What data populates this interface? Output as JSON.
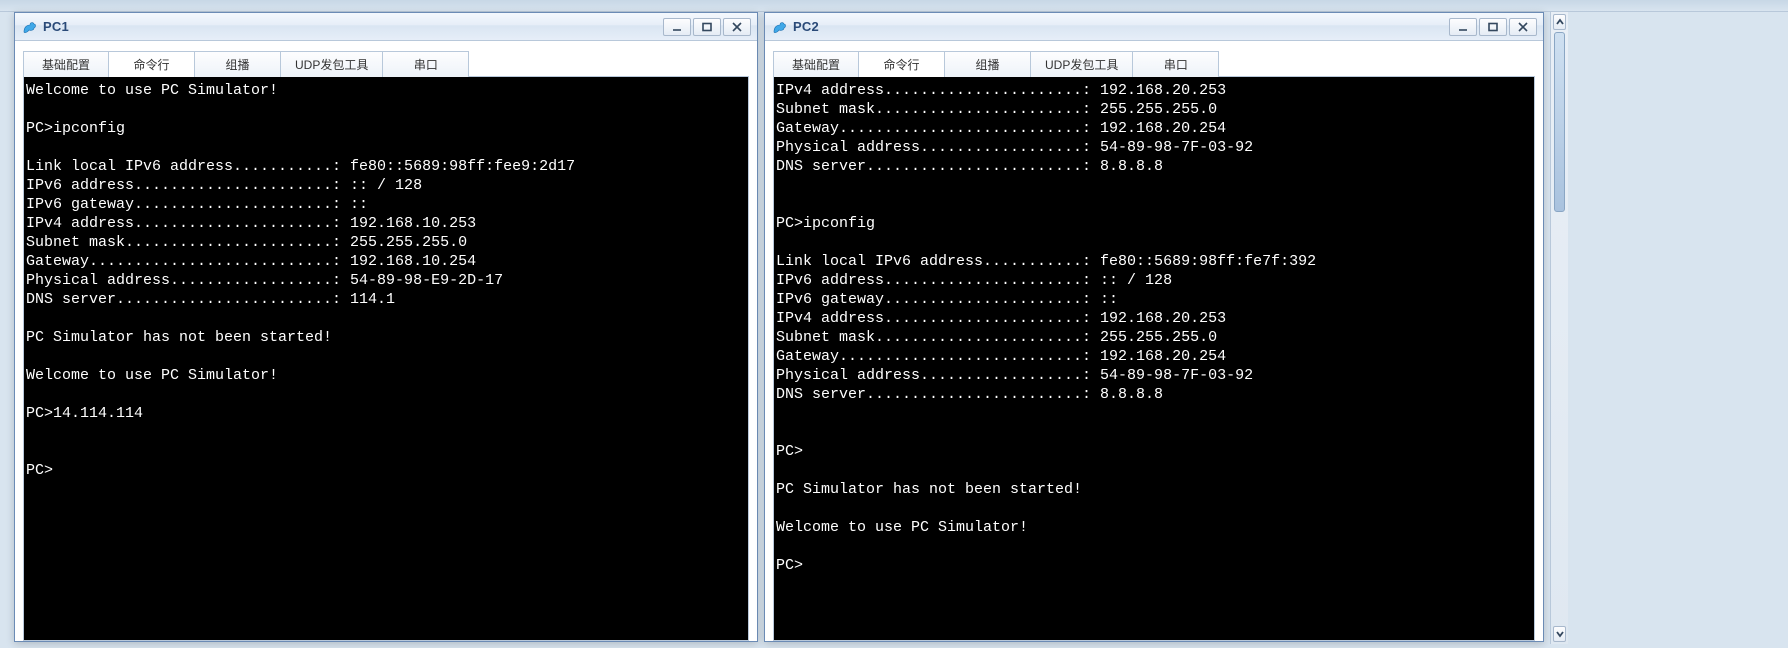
{
  "tabs": {
    "basic": "基础配置",
    "cmd": "命令行",
    "multicast": "组播",
    "udp": "UDP发包工具",
    "serial": "串口"
  },
  "pc1": {
    "title": "PC1",
    "terminal": "Welcome to use PC Simulator!\n\nPC>ipconfig\n\nLink local IPv6 address...........: fe80::5689:98ff:fee9:2d17\nIPv6 address......................: :: / 128\nIPv6 gateway......................: ::\nIPv4 address......................: 192.168.10.253\nSubnet mask.......................: 255.255.255.0\nGateway...........................: 192.168.10.254\nPhysical address..................: 54-89-98-E9-2D-17\nDNS server........................: 114.1\n\nPC Simulator has not been started!\n\nWelcome to use PC Simulator!\n\nPC>14.114.114\n\n\nPC>"
  },
  "pc2": {
    "title": "PC2",
    "terminal": "IPv4 address......................: 192.168.20.253\nSubnet mask.......................: 255.255.255.0\nGateway...........................: 192.168.20.254\nPhysical address..................: 54-89-98-7F-03-92\nDNS server........................: 8.8.8.8\n\n\nPC>ipconfig\n\nLink local IPv6 address...........: fe80::5689:98ff:fe7f:392\nIPv6 address......................: :: / 128\nIPv6 gateway......................: ::\nIPv4 address......................: 192.168.20.253\nSubnet mask.......................: 255.255.255.0\nGateway...........................: 192.168.20.254\nPhysical address..................: 54-89-98-7F-03-92\nDNS server........................: 8.8.8.8\n\n\nPC>\n\nPC Simulator has not been started!\n\nWelcome to use PC Simulator!\n\nPC>"
  }
}
